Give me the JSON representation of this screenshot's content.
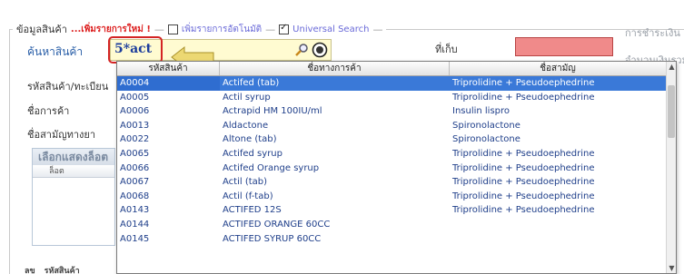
{
  "form": {
    "section_title": "ข้อมูลสินค้า",
    "new_item_link": "...เพิ่มรายการใหม่ !",
    "auto_add_label": "เพิ่มรายการอัตโนมัติ",
    "auto_add_checked": false,
    "universal_search_label": "Universal Search",
    "universal_search_checked": true,
    "search_label": "ค้นหาสินค้า",
    "search_value": "5*act",
    "code_label": "รหัสสินค้า/ทะเบียน",
    "trade_label": "ชื่อการค้า",
    "generic_label": "ชื่อสามัญทางยา",
    "storage_label": "ที่เก็บ",
    "payment_label": "การชำระเงิน",
    "amount_label": "จำนวนเงินรวม",
    "lot_header": "เลือกแสดงล็อต",
    "lot_column": "ล็อต",
    "bottom_col_1": "ลข",
    "bottom_col_2": "รหัสสินค้า"
  },
  "icons": {
    "search": "magnifier-icon",
    "clear": "clear-search-icon",
    "arrow": "left-arrow-annotation"
  },
  "colors": {
    "highlight_red": "#d42424",
    "selection_blue": "#3a79d8",
    "storage_pink": "#f08a8a"
  },
  "grid": {
    "columns": [
      "รหัสสินค้า",
      "ชื่อทางการค้า",
      "ชื่อสามัญ"
    ],
    "selected_index": 0,
    "rows": [
      [
        "A0004",
        "Actifed (tab)",
        "Triprolidine + Pseudoephedrine"
      ],
      [
        "A0005",
        "Actil syrup",
        "Triprolidine + Pseudoephedrine"
      ],
      [
        "A0006",
        "Actrapid HM 100IU/ml",
        "Insulin lispro"
      ],
      [
        "A0013",
        "Aldactone",
        "Spironolactone"
      ],
      [
        "A0022",
        "Altone (tab)",
        "Spironolactone"
      ],
      [
        "A0065",
        "Actifed syrup",
        "Triprolidine + Pseudoephedrine"
      ],
      [
        "A0066",
        "Actifed Orange syrup",
        "Triprolidine + Pseudoephedrine"
      ],
      [
        "A0067",
        "Actil (tab)",
        "Triprolidine + Pseudoephedrine"
      ],
      [
        "A0068",
        "Actil (f-tab)",
        "Triprolidine + Pseudoephedrine"
      ],
      [
        "A0143",
        "ACTIFED 12S",
        "Triprolidine + Pseudoephedrine"
      ],
      [
        "A0144",
        "ACTIFED ORANGE 60CC",
        ""
      ],
      [
        "A0145",
        "ACTIFED SYRUP 60CC",
        ""
      ]
    ]
  }
}
